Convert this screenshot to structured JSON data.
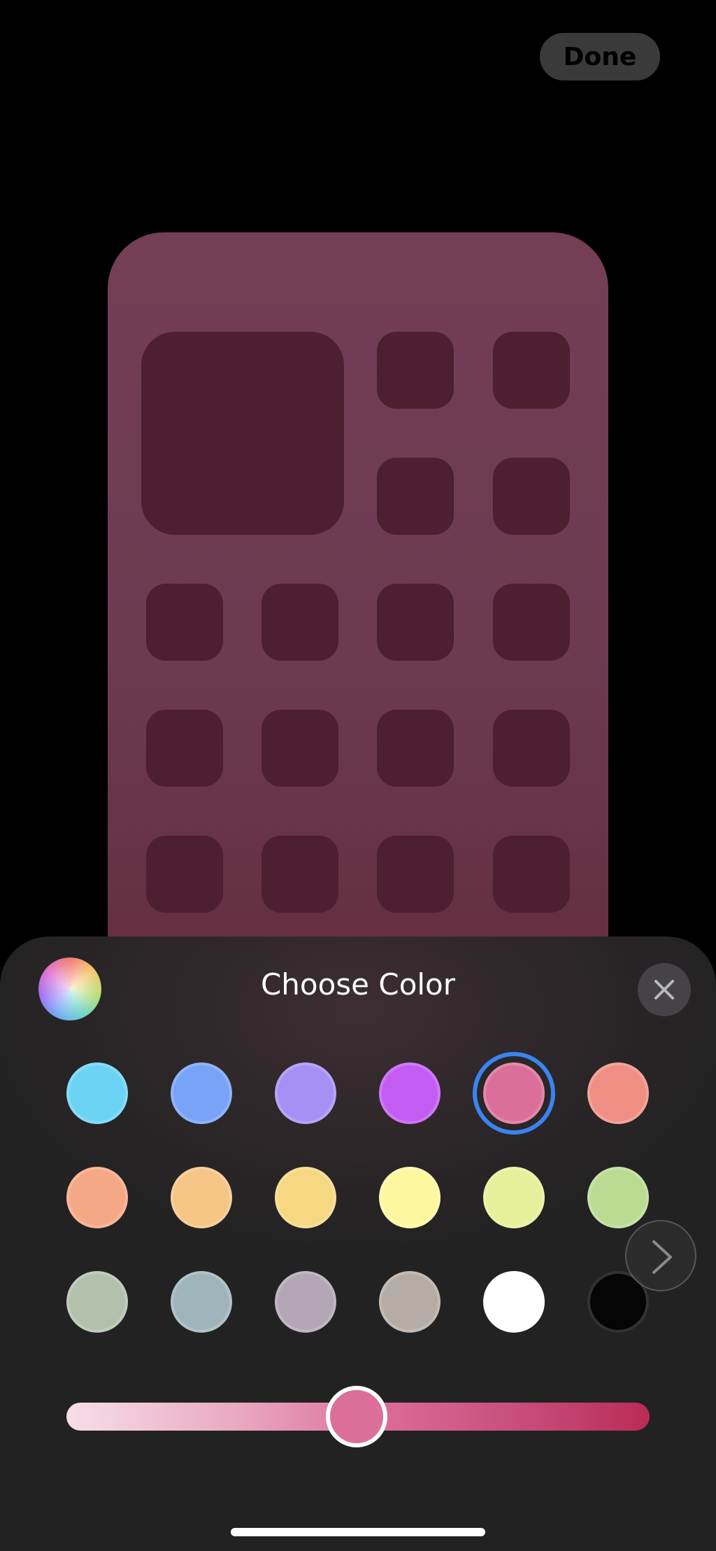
{
  "header": {
    "done_label": "Done"
  },
  "sheet": {
    "title": "Choose Color",
    "colors": {
      "row1": [
        "#6dd3f5",
        "#78a3f7",
        "#a790f4",
        "#c35cf3",
        "#dc6f99",
        "#ef8f83"
      ],
      "row2": [
        "#f5a886",
        "#f4c585",
        "#f6d782",
        "#fdf8a0",
        "#e6f09a",
        "#bbdb93"
      ],
      "row3": [
        "#b2c1ac",
        "#a0b5bb",
        "#b3a6b5",
        "#b5aca5",
        "#ffffff",
        "#050505"
      ],
      "selected": "#dc6f99",
      "selected_position": "row1-5"
    },
    "slider": {
      "value": 0.5,
      "thumb_color": "#dc6f99"
    }
  },
  "theme": {
    "wallpaper": "#743e55",
    "tile": "#4d1f31",
    "accent": "#3a84f0"
  }
}
